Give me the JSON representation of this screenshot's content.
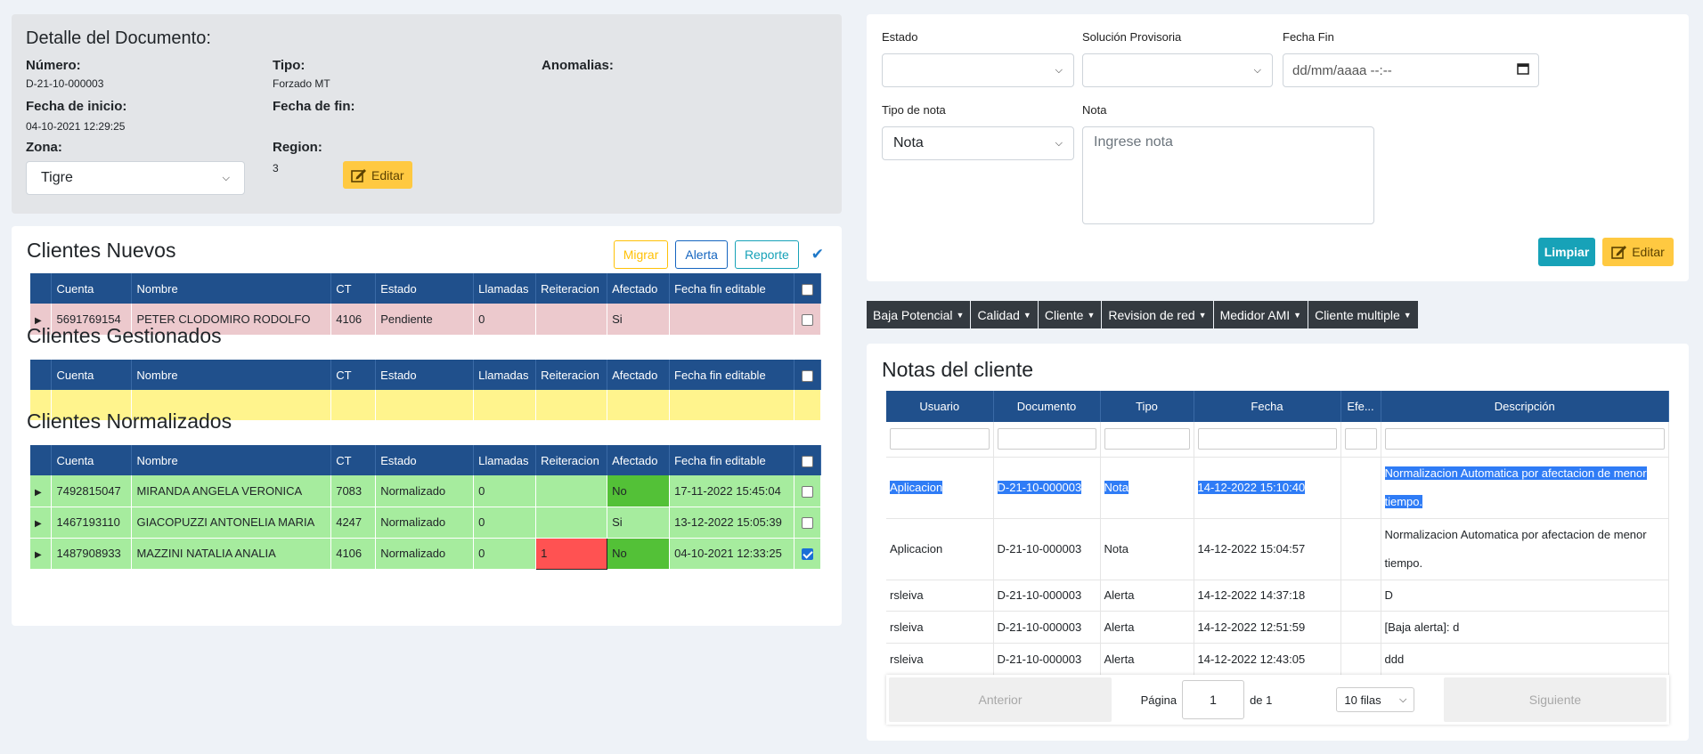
{
  "detail": {
    "title": "Detalle del Documento:",
    "numero_label": "Número:",
    "numero_value": "D-21-10-000003",
    "tipo_label": "Tipo:",
    "tipo_value": "Forzado MT",
    "anomalias_label": "Anomalias:",
    "fecha_inicio_label": "Fecha de inicio:",
    "fecha_inicio_value": "04-10-2021 12:29:25",
    "fecha_fin_label": "Fecha de fin:",
    "zona_label": "Zona:",
    "zona_value": "Tigre",
    "region_label": "Region:",
    "region_value": "3",
    "edit_label": "Editar"
  },
  "clients": {
    "nuevos_title": "Clientes Nuevos",
    "gestionados_title": "Clientes Gestionados",
    "normalizados_title": "Clientes Normalizados",
    "btn_migrar": "Migrar",
    "btn_alerta": "Alerta",
    "btn_reporte": "Reporte",
    "headers": [
      "Cuenta",
      "Nombre",
      "CT",
      "Estado",
      "Llamadas",
      "Reiteracion",
      "Afectado",
      "Fecha fin editable"
    ],
    "nuevos_rows": [
      {
        "cuenta": "5691769154",
        "nombre": "PETER CLODOMIRO RODOLFO",
        "ct": "4106",
        "estado": "Pendiente",
        "llamadas": "0",
        "reiteracion": "",
        "afectado": "Si",
        "fecha": ""
      }
    ],
    "normalizados_rows": [
      {
        "cuenta": "7492815047",
        "nombre": "MIRANDA ANGELA VERONICA",
        "ct": "7083",
        "estado": "Normalizado",
        "llamadas": "0",
        "reiteracion": "",
        "afectado": "No",
        "fecha": "17-11-2022 15:45:04"
      },
      {
        "cuenta": "1467193110",
        "nombre": "GIACOPUZZI ANTONELIA MARIA",
        "ct": "4247",
        "estado": "Normalizado",
        "llamadas": "0",
        "reiteracion": "",
        "afectado": "Si",
        "fecha": "13-12-2022 15:05:39"
      },
      {
        "cuenta": "1487908933",
        "nombre": "MAZZINI NATALIA ANALIA",
        "ct": "4106",
        "estado": "Normalizado",
        "llamadas": "0",
        "reiteracion": "1",
        "afectado": "No",
        "fecha": "04-10-2021 12:33:25"
      }
    ]
  },
  "form": {
    "estado_label": "Estado",
    "solucion_label": "Solución Provisoria",
    "fecha_fin_label": "Fecha Fin",
    "fecha_placeholder": "dd/mm/aaaa --:--",
    "tipo_nota_label": "Tipo de nota",
    "tipo_nota_value": "Nota",
    "nota_label": "Nota",
    "nota_placeholder": "Ingrese nota",
    "limpiar_label": "Limpiar",
    "editar_label": "Editar"
  },
  "dropdowns": [
    "Baja Potencial",
    "Calidad",
    "Cliente",
    "Revision de red",
    "Medidor AMI",
    "Cliente multiple"
  ],
  "notes": {
    "title": "Notas del cliente",
    "headers": [
      "Usuario",
      "Documento",
      "Tipo",
      "Fecha",
      "Efe...",
      "Descripción"
    ],
    "rows": [
      {
        "usuario": "Aplicacion",
        "documento": "D-21-10-000003",
        "tipo": "Nota",
        "fecha": "14-12-2022 15:10:40",
        "efe": "",
        "descripcion_1": "Normalizacion Automatica por afectacion de menor",
        "descripcion_2": "tiempo."
      },
      {
        "usuario": "Aplicacion",
        "documento": "D-21-10-000003",
        "tipo": "Nota",
        "fecha": "14-12-2022 15:04:57",
        "efe": "",
        "descripcion_1": "Normalizacion Automatica por afectacion de menor",
        "descripcion_2": "tiempo."
      },
      {
        "usuario": "rsleiva",
        "documento": "D-21-10-000003",
        "tipo": "Alerta",
        "fecha": "14-12-2022 14:37:18",
        "efe": "",
        "descripcion_1": "D",
        "descripcion_2": ""
      },
      {
        "usuario": "rsleiva",
        "documento": "D-21-10-000003",
        "tipo": "Alerta",
        "fecha": "14-12-2022 12:51:59",
        "efe": "",
        "descripcion_1": "[Baja alerta]: d",
        "descripcion_2": ""
      },
      {
        "usuario": "rsleiva",
        "documento": "D-21-10-000003",
        "tipo": "Alerta",
        "fecha": "14-12-2022 12:43:05",
        "efe": "",
        "descripcion_1": "ddd",
        "descripcion_2": ""
      }
    ],
    "pager": {
      "prev": "Anterior",
      "page_label": "Página",
      "page_value": "1",
      "of_label": "de 1",
      "rows_option": "10 filas",
      "next": "Siguiente"
    }
  }
}
